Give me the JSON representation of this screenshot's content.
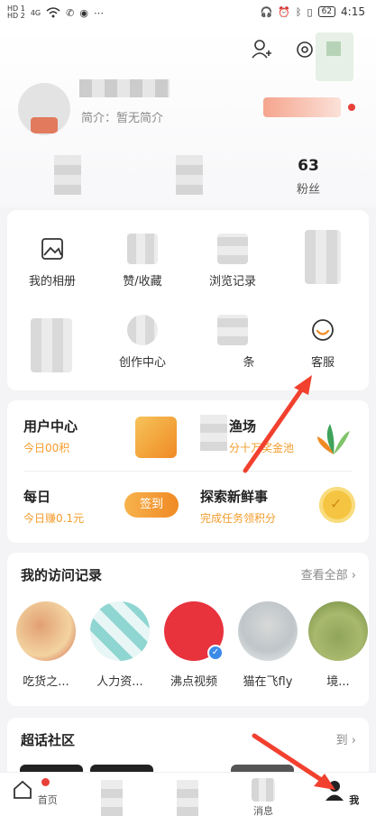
{
  "status_bar": {
    "sim1": "HD 1",
    "sim2": "HD 2",
    "net": "4G",
    "battery": "62",
    "time": "4:15"
  },
  "profile": {
    "bio": "简介：暂无简介",
    "stats": [
      {
        "value": "63",
        "label": "粉丝"
      }
    ]
  },
  "quick_grid": [
    {
      "label": "我的相册",
      "icon": "photo-album-icon"
    },
    {
      "label": "赞/收藏",
      "icon": "like-collect-icon"
    },
    {
      "label": "浏览记录",
      "icon": "history-icon"
    },
    {
      "label": "",
      "icon": "blurred-icon"
    },
    {
      "label": "",
      "icon": "blurred-icon"
    },
    {
      "label": "创作中心",
      "icon": "creator-icon"
    },
    {
      "label": "条",
      "icon": "blurred-icon"
    },
    {
      "label": "客服",
      "icon": "customer-service-icon"
    }
  ],
  "services": {
    "row1": {
      "left_title": "用户中心",
      "left_sub": "今日00积",
      "right_title": "渔场",
      "right_sub": "分十万奖金池"
    },
    "row2": {
      "left_title": "每日",
      "left_sub": "今日赚0.1元",
      "sign_label": "签到",
      "right_title": "探索新鲜事",
      "right_sub": "完成任务领积分"
    }
  },
  "visits": {
    "title": "我的访问记录",
    "more": "查看全部",
    "items": [
      {
        "label": "吃货之..."
      },
      {
        "label": "人力资..."
      },
      {
        "label": "沸点视频"
      },
      {
        "label": "猫在飞fly"
      },
      {
        "label": "境..."
      }
    ]
  },
  "topics": {
    "title": "超话社区",
    "more": "到"
  },
  "tabbar": {
    "items": [
      {
        "label": "首页"
      },
      {
        "label": "消息"
      },
      {
        "label": "我"
      }
    ]
  }
}
